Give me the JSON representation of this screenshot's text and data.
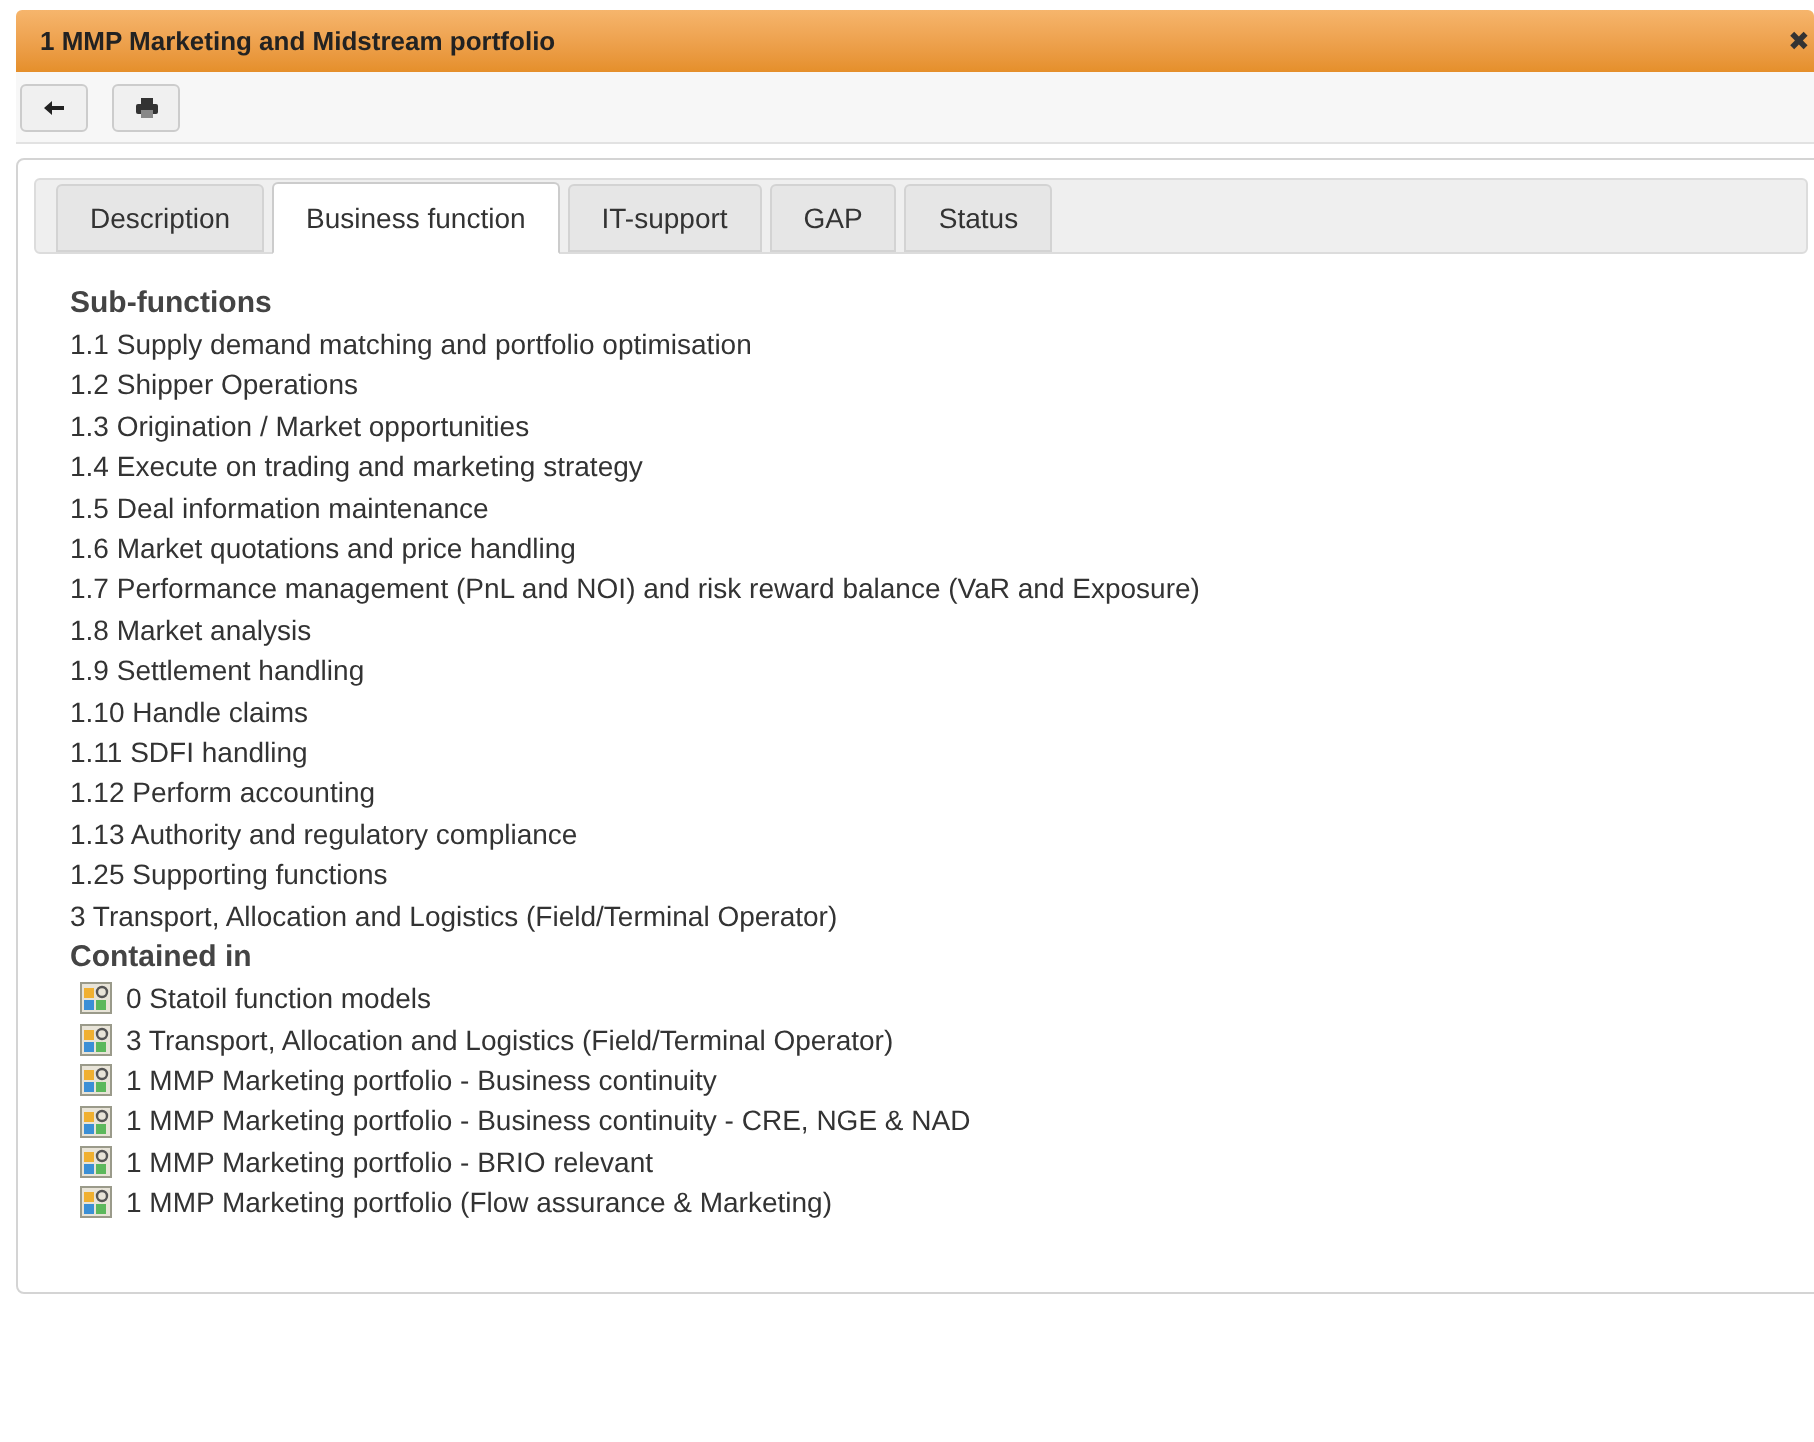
{
  "window": {
    "title": "1 MMP Marketing and Midstream portfolio",
    "close": "✖"
  },
  "tabs": [
    {
      "label": "Description",
      "selected": false
    },
    {
      "label": "Business function",
      "selected": true
    },
    {
      "label": "IT-support",
      "selected": false
    },
    {
      "label": "GAP",
      "selected": false
    },
    {
      "label": "Status",
      "selected": false
    }
  ],
  "sub_functions": {
    "heading": "Sub-functions",
    "items": [
      "1.1 Supply demand matching and portfolio optimisation",
      "1.2 Shipper Operations",
      "1.3 Origination / Market opportunities",
      "1.4 Execute on trading and marketing strategy",
      "1.5 Deal information maintenance",
      "1.6 Market quotations and price handling",
      "1.7 Performance management (PnL and NOI) and risk reward balance (VaR and Exposure)",
      "1.8 Market analysis",
      "1.9 Settlement handling",
      "1.10 Handle claims",
      "1.11 SDFI handling",
      "1.12 Perform accounting",
      "1.13 Authority and regulatory compliance",
      "1.25 Supporting functions",
      "3 Transport, Allocation and Logistics (Field/Terminal Operator)"
    ]
  },
  "contained_in": {
    "heading": "Contained in",
    "items": [
      "0 Statoil function models",
      "3 Transport, Allocation and Logistics (Field/Terminal Operator)",
      "1 MMP Marketing portfolio - Business continuity",
      "1 MMP Marketing portfolio - Business continuity - CRE, NGE & NAD",
      "1 MMP Marketing portfolio - BRIO relevant",
      "1 MMP Marketing portfolio (Flow assurance & Marketing)"
    ]
  }
}
